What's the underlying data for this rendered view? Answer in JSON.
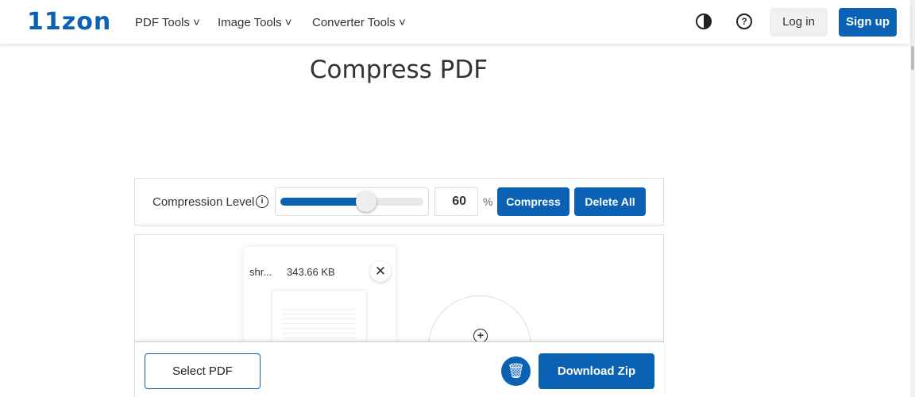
{
  "header": {
    "logo": "11zon",
    "nav": [
      "PDF Tools",
      "Image Tools",
      "Converter Tools"
    ],
    "login": "Log in",
    "signup": "Sign up"
  },
  "page": {
    "title": "Compress PDF"
  },
  "controls": {
    "label": "Compression Level",
    "level": 60,
    "level_text": "60",
    "unit": "%",
    "compress": "Compress",
    "delete_all": "Delete All"
  },
  "file": {
    "name": "shr...",
    "size": "343.66 KB"
  },
  "footer": {
    "select": "Select PDF",
    "download": "Download Zip"
  },
  "colors": {
    "brand": "#0b62b5"
  }
}
